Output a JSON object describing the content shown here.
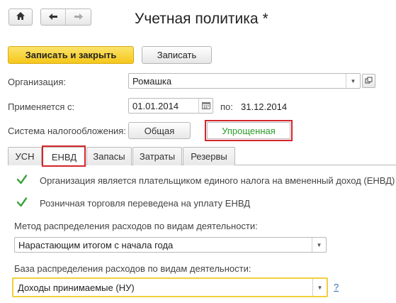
{
  "toolbar": {
    "home_icon": "home-icon",
    "back_icon": "arrow-left-icon",
    "forward_icon": "arrow-right-icon"
  },
  "window": {
    "title": "Учетная политика *"
  },
  "actions": {
    "save_close_label": "Записать и закрыть",
    "save_label": "Записать"
  },
  "form": {
    "organization": {
      "label": "Организация:",
      "value": "Ромашка"
    },
    "period": {
      "label": "Применяется с:",
      "from": "01.01.2014",
      "to_label": "по:",
      "to": "31.12.2014"
    },
    "tax_system": {
      "label": "Система налогообложения:",
      "options": [
        "Общая",
        "Упрощенная"
      ],
      "selected": "Упрощенная",
      "selected_color": "#2a9d2a"
    }
  },
  "tabs": [
    {
      "label": "УСН"
    },
    {
      "label": "ЕНВД",
      "active": true
    },
    {
      "label": "Запасы"
    },
    {
      "label": "Затраты"
    },
    {
      "label": "Резервы"
    }
  ],
  "envd": {
    "checkbox1": {
      "label": "Организация является плательщиком единого налога на вмененный доход (ЕНВД)",
      "checked": true
    },
    "checkbox2": {
      "label": "Розничная торговля переведена на уплату ЕНВД",
      "checked": true
    },
    "method": {
      "label": "Метод распределения расходов по видам деятельности:",
      "value": "Нарастающим итогом с начала года"
    },
    "base": {
      "label": "База распределения расходов по видам деятельности:",
      "value": "Доходы принимаемые (НУ)",
      "help": "?"
    }
  },
  "colors": {
    "accent_yellow": "#f5c71a",
    "highlight_red": "#d3262b",
    "check_green": "#3aa13a",
    "link_blue": "#2e6fb5"
  }
}
